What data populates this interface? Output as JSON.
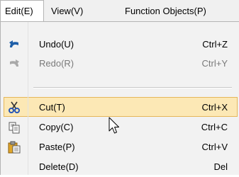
{
  "menubar": {
    "items": [
      {
        "label": "Edit(E)",
        "open": true
      },
      {
        "label": "View(V)"
      },
      {
        "label": "Function Objects(P)"
      }
    ]
  },
  "dropdown": {
    "items": [
      {
        "label": "Undo(U)",
        "shortcut": "Ctrl+Z",
        "icon": "undo-icon",
        "enabled": true
      },
      {
        "label": "Redo(R)",
        "shortcut": "Ctrl+Y",
        "icon": "redo-icon",
        "enabled": false
      },
      {
        "label": "Cut(T)",
        "shortcut": "Ctrl+X",
        "icon": "scissors-icon",
        "enabled": true,
        "highlighted": true
      },
      {
        "label": "Copy(C)",
        "shortcut": "Ctrl+C",
        "icon": "copy-icon",
        "enabled": true
      },
      {
        "label": "Paste(P)",
        "shortcut": "Ctrl+V",
        "icon": "paste-icon",
        "enabled": true
      },
      {
        "label": "Delete(D)",
        "shortcut": "Del",
        "icon": "",
        "enabled": true
      }
    ]
  },
  "colors": {
    "menubar_bg": "#f0f0f0",
    "menu_bg": "#f2f2f2",
    "highlight_bg": "#fce8b5",
    "highlight_border": "#e5b75a",
    "disabled_text": "#7a7a7a"
  }
}
